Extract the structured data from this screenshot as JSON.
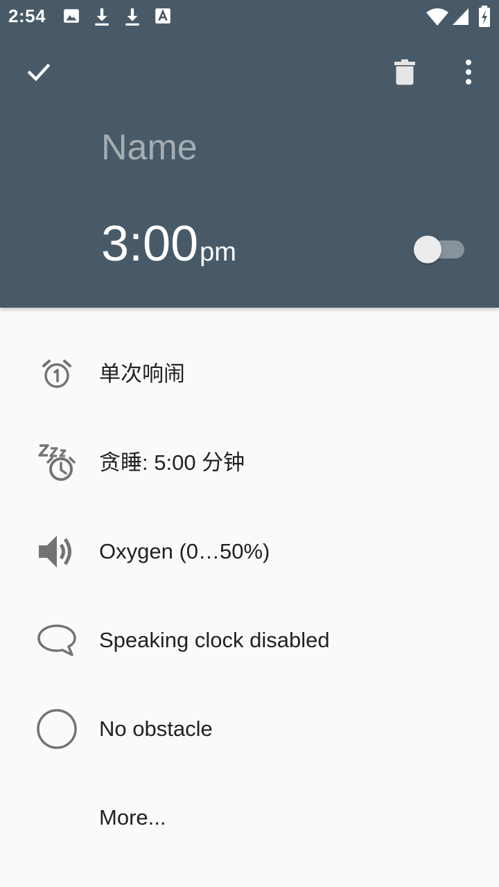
{
  "status_bar": {
    "time": "2:54",
    "left_icons": [
      "image-icon",
      "download-icon",
      "download-icon",
      "a-letter-icon"
    ],
    "right_icons": [
      "wifi-icon",
      "signal-icon",
      "battery-charging-icon"
    ]
  },
  "app_bar": {
    "icons": [
      "check-icon",
      "delete-icon",
      "more-vert-icon"
    ]
  },
  "alarm": {
    "name_placeholder": "Name",
    "time": "3:00",
    "time_suffix": "pm",
    "enabled": false
  },
  "list": [
    {
      "icon": "alarm-once-icon",
      "label": "单次响闹"
    },
    {
      "icon": "snooze-icon",
      "label": "贪睡: 5:00 分钟"
    },
    {
      "icon": "volume-icon",
      "label": "Oxygen (0…50%)"
    },
    {
      "icon": "speech-bubble-icon",
      "label": "Speaking clock disabled"
    },
    {
      "icon": "circle-icon",
      "label": "No obstacle"
    },
    {
      "icon": "",
      "label": "More..."
    }
  ],
  "colors": {
    "header": "#485A67",
    "background": "#FAFAFA",
    "icon_gray": "#737373",
    "text": "#212121"
  }
}
